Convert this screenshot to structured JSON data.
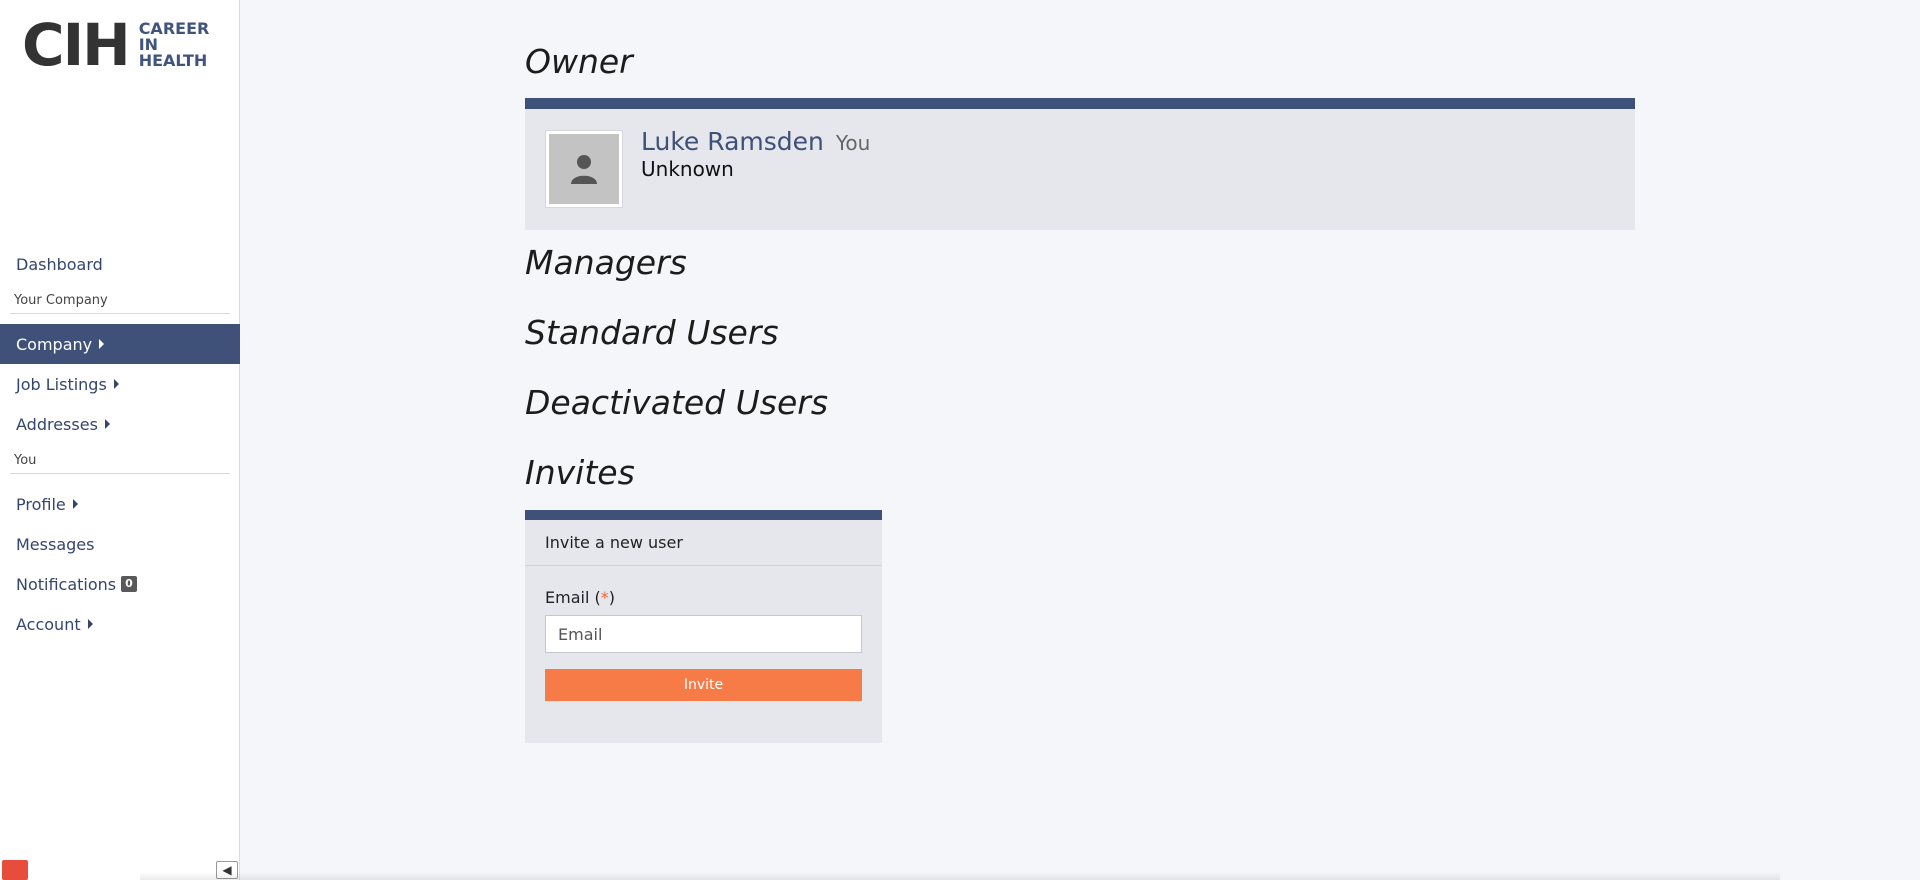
{
  "brand": {
    "logo_mark": "CIH",
    "logo_text": "CAREER IN HEALTH",
    "accent_color": "#3f5079",
    "button_color": "#f77b47"
  },
  "sidebar": {
    "dashboard": "Dashboard",
    "section_company": "Your Company",
    "company": "Company",
    "job_listings": "Job Listings",
    "addresses": "Addresses",
    "section_you": "You",
    "profile": "Profile",
    "messages": "Messages",
    "notifications": "Notifications",
    "notifications_count": "0",
    "account": "Account"
  },
  "main": {
    "owner_title": "Owner",
    "owner": {
      "name": "Luke Ramsden",
      "you_label": "You",
      "status": "Unknown"
    },
    "managers_title": "Managers",
    "standard_users_title": "Standard Users",
    "deactivated_users_title": "Deactivated Users",
    "invites_title": "Invites",
    "invite": {
      "header": "Invite a new user",
      "email_label": "Email (",
      "email_required": "*",
      "email_label_end": ")",
      "email_placeholder": "Email",
      "button_label": "Invite"
    }
  }
}
